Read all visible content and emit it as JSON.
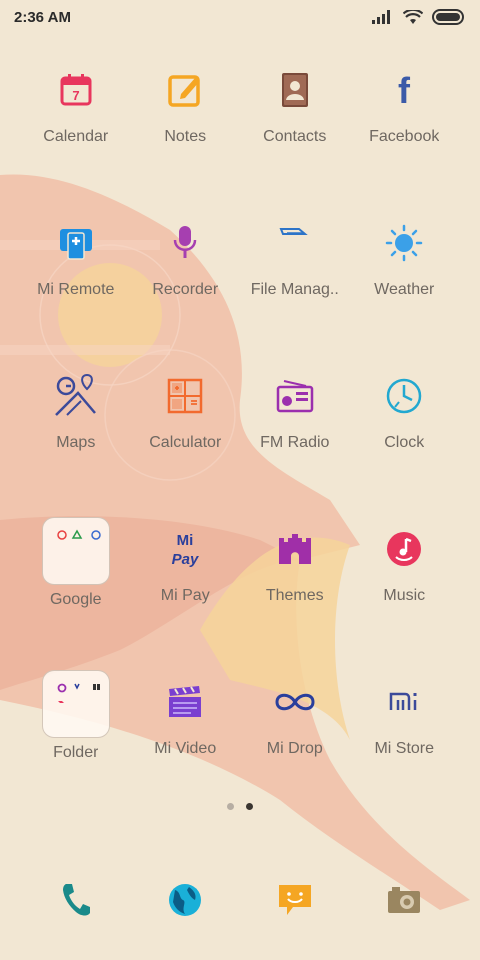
{
  "status_bar": {
    "time": "2:36 AM",
    "icons": [
      "signal-icon",
      "wifi-icon",
      "battery-icon"
    ]
  },
  "apps": [
    {
      "label": "Calendar",
      "icon": "calendar-icon",
      "icon_text": "7",
      "color": "#e8365d"
    },
    {
      "label": "Notes",
      "icon": "notes-icon",
      "color": "#f5a623"
    },
    {
      "label": "Contacts",
      "icon": "contacts-icon",
      "color": "#7a4a3a"
    },
    {
      "label": "Facebook",
      "icon": "facebook-icon",
      "icon_text": "f",
      "color": "#3b5aa8"
    },
    {
      "label": "Mi Remote",
      "icon": "remote-icon",
      "color": "#1e8fe0"
    },
    {
      "label": "Recorder",
      "icon": "microphone-icon",
      "color": "#a63fb0"
    },
    {
      "label": "File Manag..",
      "icon": "folder-file-icon",
      "color": "#2d74c8"
    },
    {
      "label": "Weather",
      "icon": "sun-icon",
      "color": "#3ba0e8"
    },
    {
      "label": "Maps",
      "icon": "map-icon",
      "color": "#3c4a9a"
    },
    {
      "label": "Calculator",
      "icon": "calculator-icon",
      "color": "#f26a2e"
    },
    {
      "label": "FM Radio",
      "icon": "radio-icon",
      "color": "#9b2fae"
    },
    {
      "label": "Clock",
      "icon": "clock-icon",
      "color": "#22a8d0"
    },
    {
      "label": "Google",
      "icon": "google-folder-icon",
      "folder": true
    },
    {
      "label": "Mi Pay",
      "icon": "mi-pay-icon",
      "icon_text_top": "Mi",
      "icon_text": "Pay",
      "color": "#2a3f9c"
    },
    {
      "label": "Themes",
      "icon": "castle-icon",
      "color": "#a02fa8"
    },
    {
      "label": "Music",
      "icon": "music-icon",
      "color": "#e8365d"
    },
    {
      "label": "Folder",
      "icon": "app-folder-icon",
      "folder": true
    },
    {
      "label": "Mi Video",
      "icon": "clapperboard-icon",
      "color": "#7a3fd0"
    },
    {
      "label": "Mi Drop",
      "icon": "infinity-icon",
      "color": "#2a3f9c"
    },
    {
      "label": "Mi Store",
      "icon": "mi-logo-icon",
      "icon_text": "mi",
      "color": "#3c4a9a"
    }
  ],
  "page_indicator": {
    "current": 2,
    "total": 2
  },
  "dock": [
    {
      "icon": "phone-icon",
      "color": "#1a8a8a"
    },
    {
      "icon": "browser-globe-icon",
      "color": "#1ab0d8"
    },
    {
      "icon": "messaging-icon",
      "color": "#f5a623"
    },
    {
      "icon": "camera-icon",
      "color": "#9a8660"
    }
  ],
  "theme": {
    "background": "#f2e7d3",
    "bird": "#f0b9a1",
    "sun": "#f6d39a"
  }
}
